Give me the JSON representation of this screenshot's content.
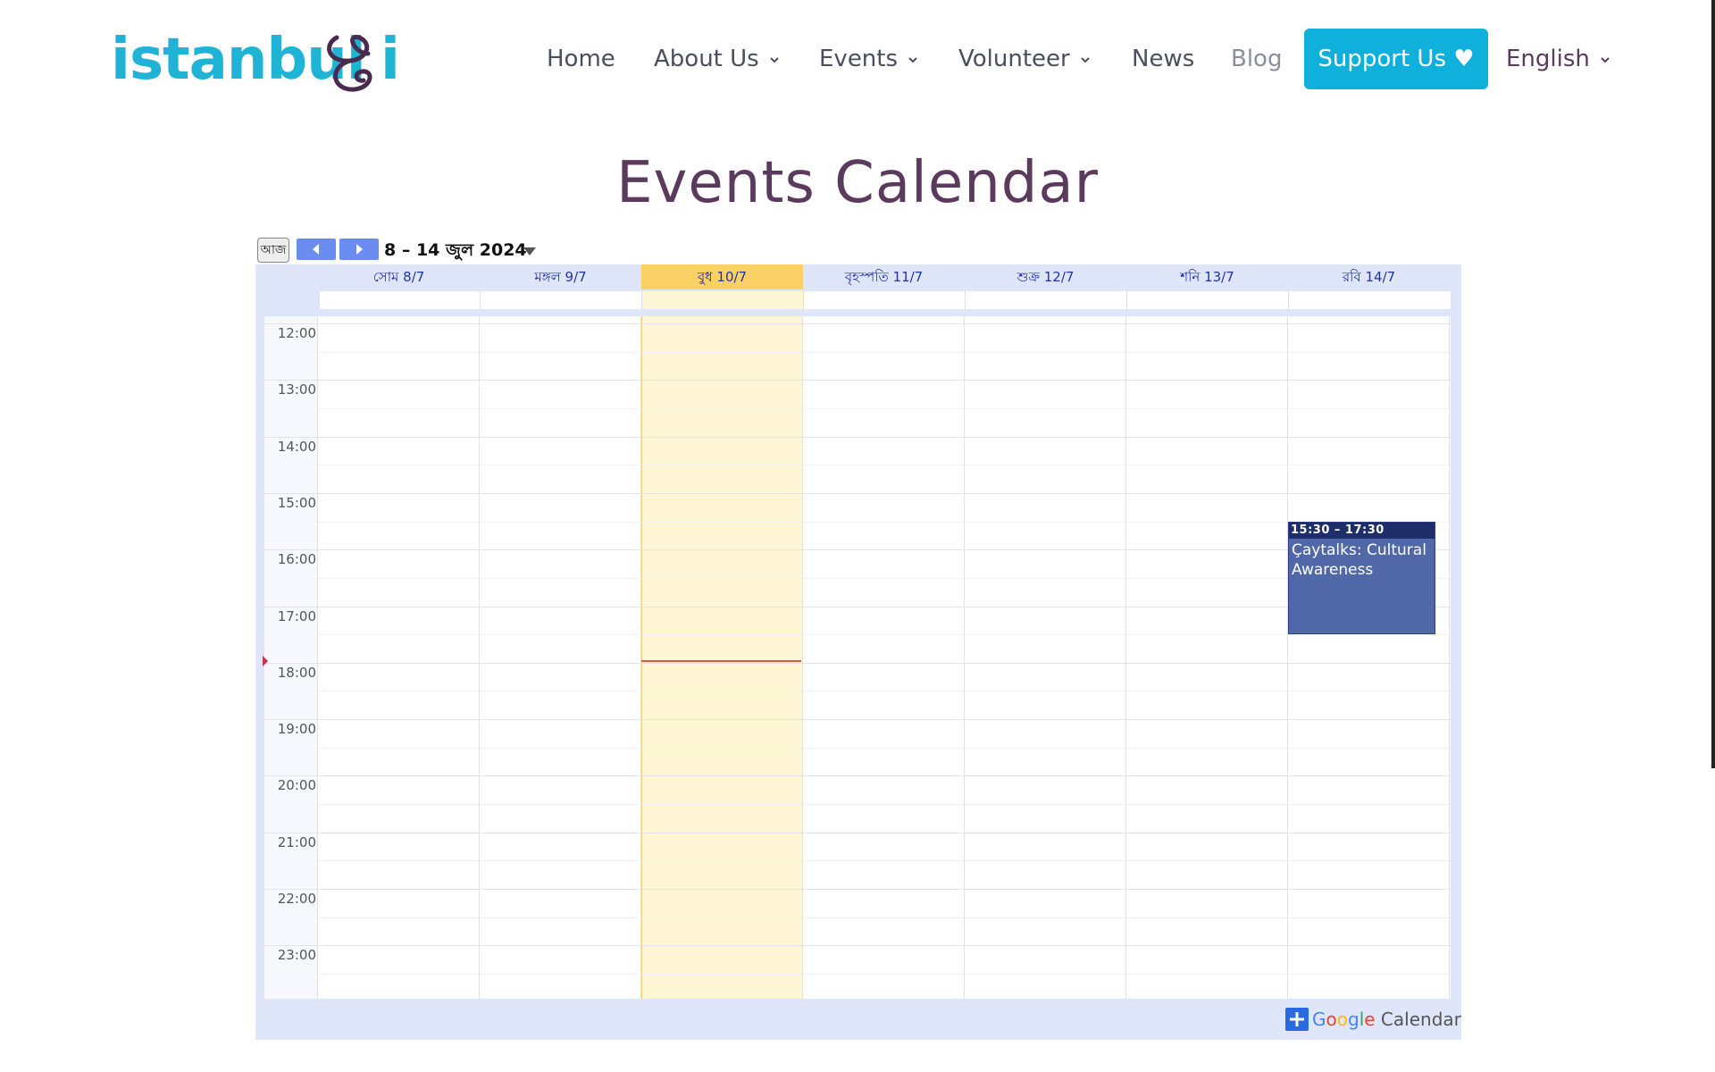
{
  "header": {
    "logo_text": "istanbul",
    "logo_tail": "i",
    "nav": {
      "home": "Home",
      "about": "About Us",
      "events": "Events",
      "volunteer": "Volunteer",
      "news": "News",
      "blog": "Blog",
      "support": "Support Us ♥",
      "language": "English"
    },
    "brand_color": "#1fb3d6",
    "support_color": "#0fb0dc"
  },
  "page": {
    "title": "Events Calendar"
  },
  "calendar": {
    "today_label": "আজ",
    "date_range": "8 – 14 জুল 2024",
    "days": [
      {
        "label": "সোম 8/7",
        "today": false
      },
      {
        "label": "মঙ্গল 9/7",
        "today": false
      },
      {
        "label": "বুধ 10/7",
        "today": true
      },
      {
        "label": "বৃহস্পতি 11/7",
        "today": false
      },
      {
        "label": "শুক্র 12/7",
        "today": false
      },
      {
        "label": "শনি 13/7",
        "today": false
      },
      {
        "label": "রবি 14/7",
        "today": false
      }
    ],
    "hours": [
      "12:00",
      "13:00",
      "14:00",
      "15:00",
      "16:00",
      "17:00",
      "18:00",
      "19:00",
      "20:00",
      "21:00",
      "22:00",
      "23:00"
    ],
    "events": [
      {
        "day_index": 6,
        "start_hour": 15.5,
        "end_hour": 17.5,
        "time": "15:30 – 17:30",
        "title": "Çaytalks: Cultural Awareness"
      }
    ],
    "now_hour": 17.95,
    "footer_badge": "Google Calendar",
    "today_color": "#fad165",
    "event_color": "#5168a8"
  }
}
